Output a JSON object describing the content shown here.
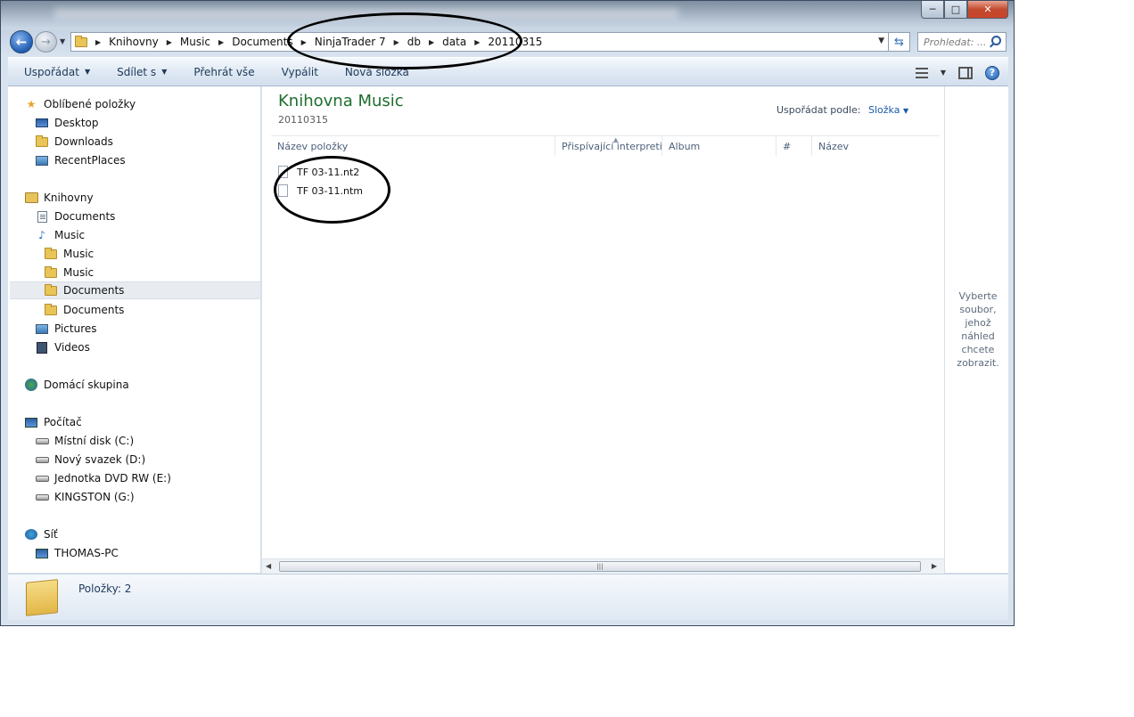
{
  "window": {
    "caption_buttons": {
      "minimize": "─",
      "maximize": "□",
      "close": "✕"
    }
  },
  "address": {
    "crumbs": [
      "Knihovny",
      "Music",
      "Documents",
      "NinjaTrader 7",
      "db",
      "data",
      "20110315"
    ],
    "search_placeholder": "Prohledat: ..."
  },
  "toolbar": {
    "organize": "Uspořádat",
    "share": "Sdílet s",
    "play_all": "Přehrát vše",
    "burn": "Vypálit",
    "new_folder": "Nová složka"
  },
  "nav_pane": {
    "favorites": "Oblíbené položky",
    "desktop": "Desktop",
    "downloads": "Downloads",
    "recent": "RecentPlaces",
    "libraries": "Knihovny",
    "lib_documents": "Documents",
    "lib_music": "Music",
    "music_1": "Music",
    "music_2": "Music",
    "documents_1": "Documents",
    "documents_2": "Documents",
    "pictures": "Pictures",
    "videos": "Videos",
    "homegroup": "Domácí skupina",
    "computer": "Počítač",
    "drive_c": "Místní disk (C:)",
    "drive_d": "Nový svazek (D:)",
    "drive_e": "Jednotka DVD RW (E:)",
    "drive_g": "KINGSTON (G:)",
    "network": "Síť",
    "thomas_pc": "THOMAS-PC"
  },
  "content": {
    "title": "Knihovna Music",
    "subtitle": "20110315",
    "arrange_label": "Uspořádat podle:",
    "arrange_value": "Složka",
    "columns": [
      "Název položky",
      "Přispívající interpreti",
      "Album",
      "#",
      "Název"
    ],
    "files": [
      "TF 03-11.nt2",
      "TF 03-11.ntm"
    ]
  },
  "preview": {
    "text": "Vyberte soubor, jehož náhled chcete zobrazit."
  },
  "details": {
    "item_count": "Položky: 2"
  },
  "colors": {
    "accent": "#1e6e2e",
    "link": "#1a5ba8",
    "toolbar_text": "#1e395b"
  }
}
